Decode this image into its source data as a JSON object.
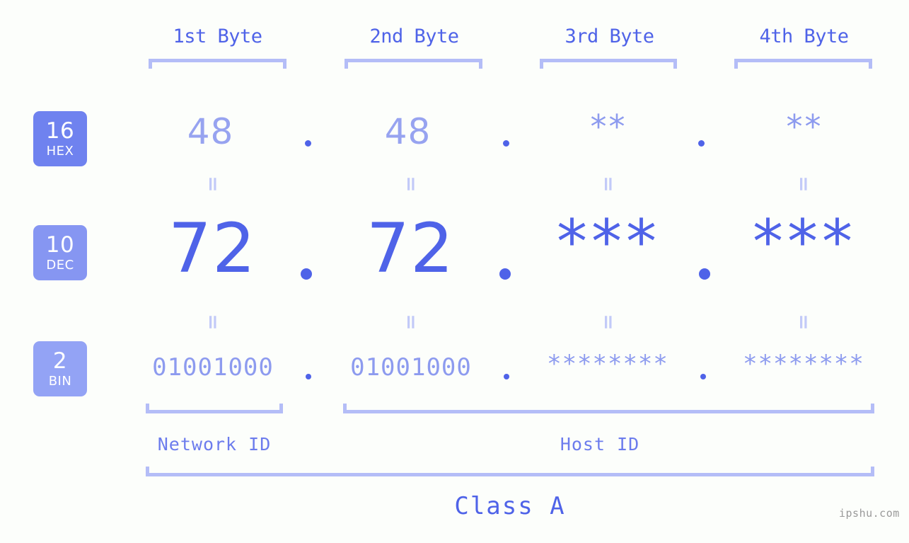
{
  "background_color": "#fcfefb",
  "accent_color": "#4f63e8",
  "accent_light_color": "#8d9bef",
  "bracket_color": "#b4bdf7",
  "headers": {
    "byte1": "1st Byte",
    "byte2": "2nd Byte",
    "byte3": "3rd Byte",
    "byte4": "4th Byte"
  },
  "bases": [
    {
      "number": "16",
      "name": "HEX",
      "color": "#6f82ef"
    },
    {
      "number": "10",
      "name": "DEC",
      "color": "#8696f2"
    },
    {
      "number": "2",
      "name": "BIN",
      "color": "#93a3f5"
    }
  ],
  "rows": {
    "hex": {
      "label_number": "16",
      "label_name": "HEX",
      "values": [
        "48",
        "48",
        "**",
        "**"
      ]
    },
    "dec": {
      "label_number": "10",
      "label_name": "DEC",
      "values": [
        "72",
        "72",
        "***",
        "***"
      ]
    },
    "bin": {
      "label_number": "2",
      "label_name": "BIN",
      "values": [
        "01001000",
        "01001000",
        "********",
        "********"
      ]
    }
  },
  "separators": {
    "dot": ".",
    "equals": "="
  },
  "footer": {
    "network_id": "Network ID",
    "host_id": "Host ID",
    "class_label": "Class A",
    "watermark": "ipshu.com"
  }
}
